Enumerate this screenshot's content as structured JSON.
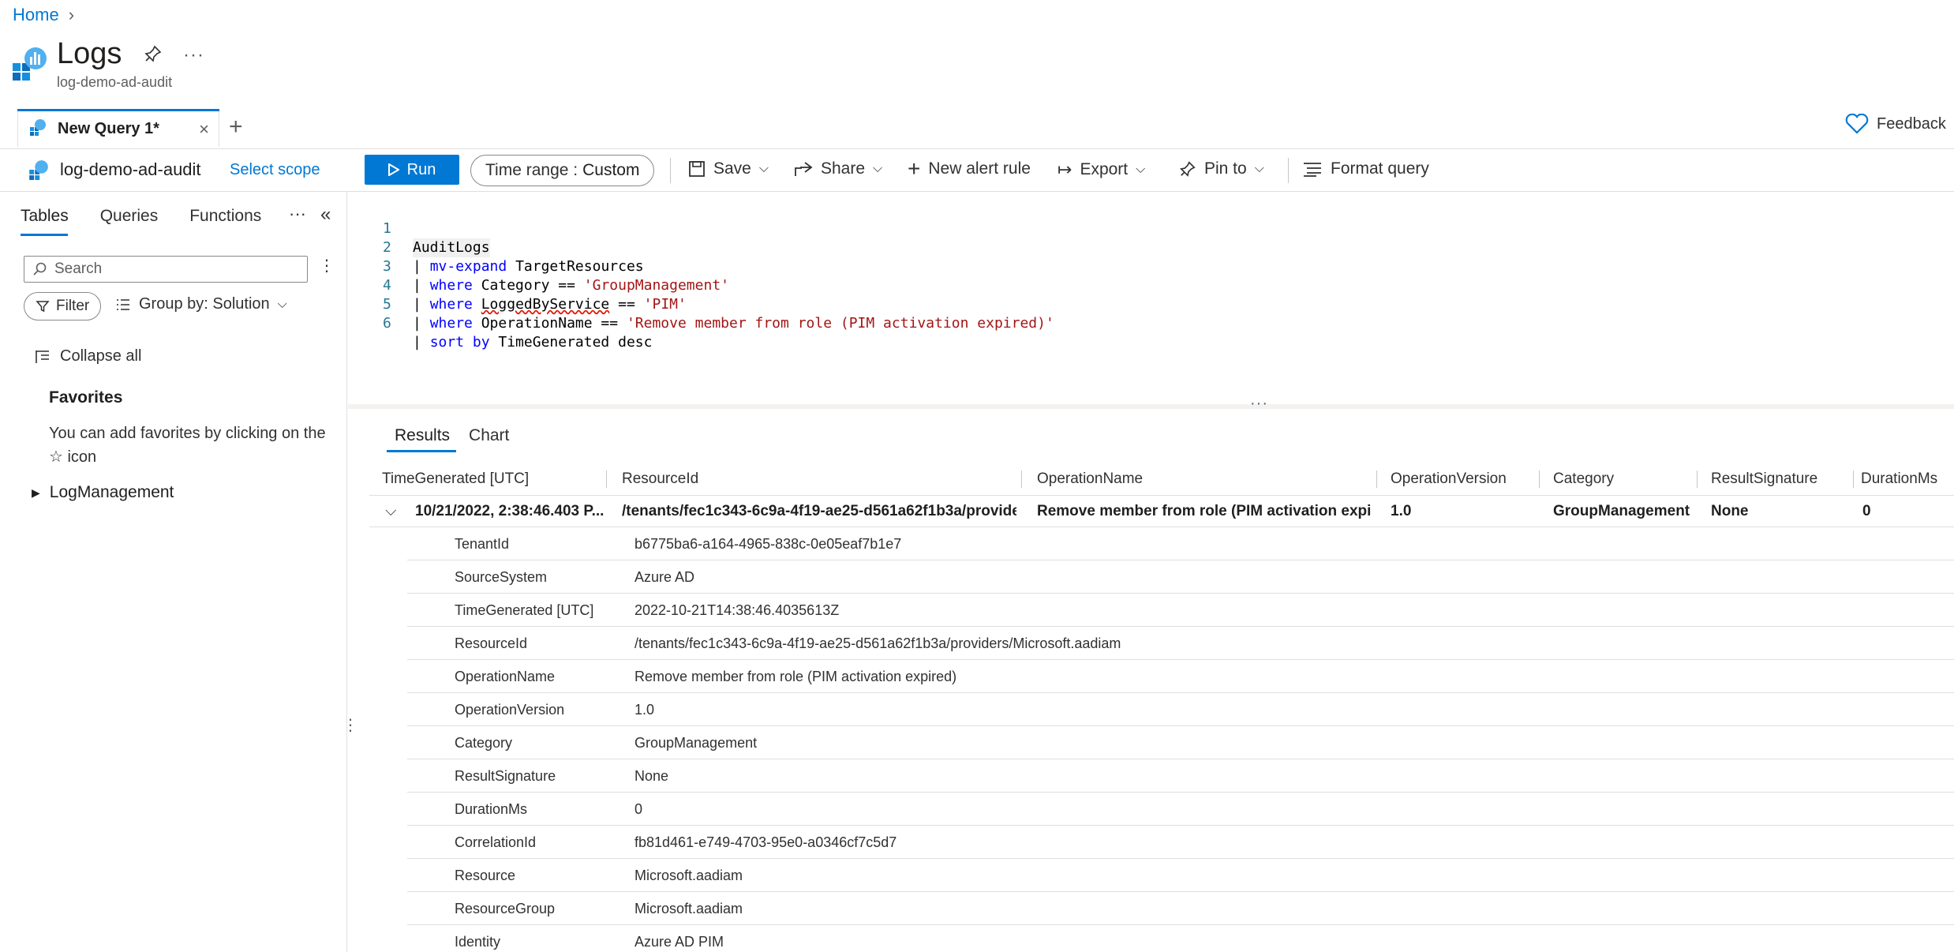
{
  "breadcrumb": {
    "home": "Home"
  },
  "header": {
    "title": "Logs",
    "subtitle": "log-demo-ad-audit"
  },
  "tabs": {
    "query_tab": "New Query 1*",
    "close": "×",
    "add": "+",
    "feedback": "Feedback"
  },
  "toolbar": {
    "scope": "log-demo-ad-audit",
    "select_scope": "Select scope",
    "run": "Run",
    "time_range_label": "Time range :",
    "time_range_value": "Custom",
    "save": "Save",
    "share": "Share",
    "new_alert": "New alert rule",
    "export": "Export",
    "pin_to": "Pin to",
    "format_query": "Format query"
  },
  "left_panel": {
    "tabs": [
      "Tables",
      "Queries",
      "Functions"
    ],
    "search_placeholder": "Search",
    "filter": "Filter",
    "group_by": "Group by: Solution",
    "collapse_all": "Collapse all",
    "favorites_title": "Favorites",
    "favorites_text": "You can add favorites by clicking on the ☆ icon",
    "log_management": "LogManagement"
  },
  "editor": {
    "lines": [
      {
        "n": "1",
        "text": "AuditLogs"
      },
      {
        "n": "2",
        "text": "| mv-expand TargetResources"
      },
      {
        "n": "3",
        "text": "| where Category == 'GroupManagement'"
      },
      {
        "n": "4",
        "text": "| where LoggedByService == 'PIM'"
      },
      {
        "n": "5",
        "text": "| where OperationName == 'Remove member from role (PIM activation expired)'"
      },
      {
        "n": "6",
        "text": "| sort by TimeGenerated desc"
      }
    ]
  },
  "results": {
    "tabs": [
      "Results",
      "Chart"
    ],
    "columns": [
      "TimeGenerated [UTC]",
      "ResourceId",
      "OperationName",
      "OperationVersion",
      "Category",
      "ResultSignature",
      "DurationMs"
    ],
    "row": [
      "10/21/2022, 2:38:46.403 P...",
      "/tenants/fec1c343-6c9a-4f19-ae25-d561a62f1b3a/provider...",
      "Remove member from role (PIM activation expir...",
      "1.0",
      "GroupManagement",
      "None",
      "0"
    ],
    "details": [
      {
        "k": "TenantId",
        "v": "b6775ba6-a164-4965-838c-0e05eaf7b1e7"
      },
      {
        "k": "SourceSystem",
        "v": "Azure AD"
      },
      {
        "k": "TimeGenerated [UTC]",
        "v": "2022-10-21T14:38:46.4035613Z"
      },
      {
        "k": "ResourceId",
        "v": "/tenants/fec1c343-6c9a-4f19-ae25-d561a62f1b3a/providers/Microsoft.aadiam"
      },
      {
        "k": "OperationName",
        "v": "Remove member from role (PIM activation expired)"
      },
      {
        "k": "OperationVersion",
        "v": "1.0"
      },
      {
        "k": "Category",
        "v": "GroupManagement"
      },
      {
        "k": "ResultSignature",
        "v": "None"
      },
      {
        "k": "DurationMs",
        "v": "0"
      },
      {
        "k": "CorrelationId",
        "v": "fb81d461-e749-4703-95e0-a0346cf7c5d7"
      },
      {
        "k": "Resource",
        "v": "Microsoft.aadiam"
      },
      {
        "k": "ResourceGroup",
        "v": "Microsoft.aadiam"
      },
      {
        "k": "Identity",
        "v": "Azure AD PIM"
      }
    ]
  },
  "colors": {
    "accent": "#0078d4",
    "string": "#a31515",
    "keyword": "#0000ff"
  }
}
